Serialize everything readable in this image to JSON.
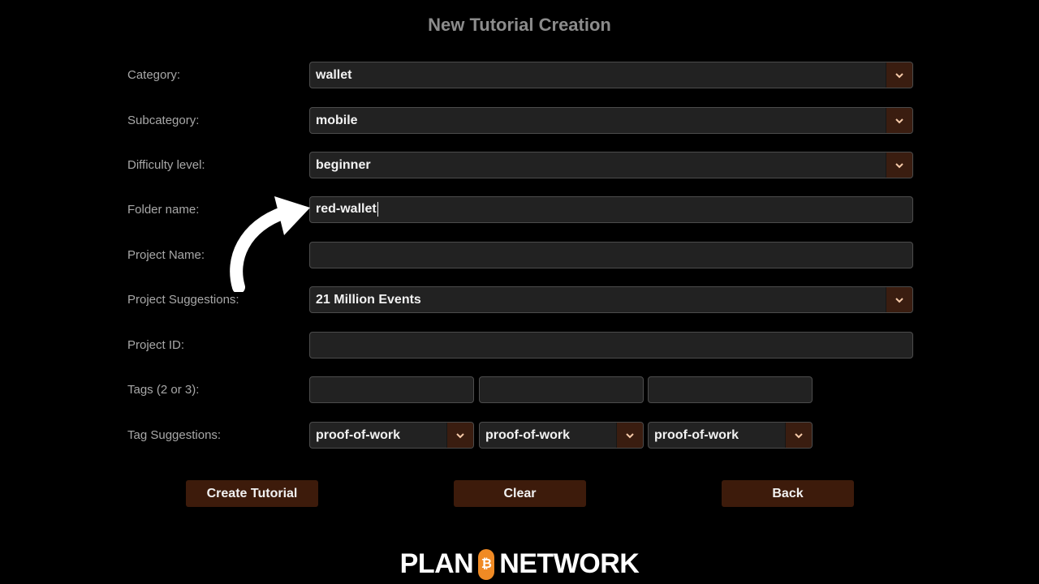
{
  "title": "New Tutorial Creation",
  "labels": {
    "category": "Category:",
    "subcategory": "Subcategory:",
    "difficulty": "Difficulty level:",
    "folder": "Folder name:",
    "project_name": "Project Name:",
    "project_suggestions": "Project Suggestions:",
    "project_id": "Project ID:",
    "tags": "Tags (2 or 3):",
    "tag_suggestions": "Tag Suggestions:"
  },
  "values": {
    "category": "wallet",
    "subcategory": "mobile",
    "difficulty": "beginner",
    "folder": "red-wallet",
    "project_name": "",
    "project_suggestion": "21 Million Events",
    "project_id": "",
    "tags": [
      "",
      "",
      ""
    ],
    "tag_suggestions": [
      "proof-of-work",
      "proof-of-work",
      "proof-of-work"
    ]
  },
  "buttons": {
    "create": "Create Tutorial",
    "clear": "Clear",
    "back": "Back"
  },
  "brand": {
    "left": "PLAN",
    "symbol": "₿",
    "right": "NETWORK"
  },
  "icons": {
    "dropdown": "chevron-down-icon",
    "pointer": "curved-arrow-icon"
  },
  "colors": {
    "background": "#000000",
    "field": "#222222",
    "accent": "#3d1b0b",
    "chevron": "#f5c9a8",
    "brand_orange": "#f08a24"
  }
}
